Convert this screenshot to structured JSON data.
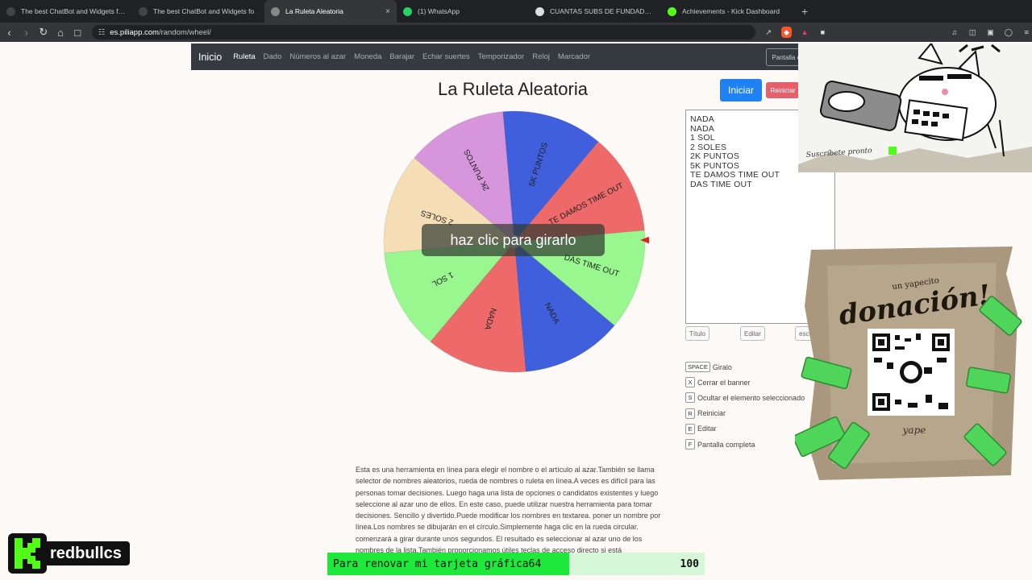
{
  "browser": {
    "tabs": [
      {
        "title": "The best ChatBot and Widgets for Ki",
        "icon": "botrix-icon",
        "color": "#444"
      },
      {
        "title": "The best ChatBot and Widgets fo",
        "icon": "botrix-icon",
        "color": "#444"
      },
      {
        "title": "La Ruleta Aleatoria",
        "icon": "piliapp-icon",
        "color": "#888",
        "active": true
      },
      {
        "title": "(1) WhatsApp",
        "icon": "whatsapp-icon",
        "color": "#25d366"
      },
      {
        "title": "CUANTAS SUBS DE FUNDADOR DAN",
        "icon": "google-icon",
        "color": "#ddd"
      },
      {
        "title": "Achievements - Kick Dashboard",
        "icon": "kick-icon",
        "color": "#53fc18"
      }
    ],
    "url_host": "es.piliapp.com",
    "url_path": "/random/wheel/"
  },
  "site": {
    "brand": "Inicio",
    "nav": [
      "Ruleta",
      "Dado",
      "Números al azar",
      "Moneda",
      "Barajar",
      "Echar suertes",
      "Temporizador",
      "Reloj",
      "Marcador"
    ],
    "active_nav": "Ruleta",
    "fullscreen_btn": "Pantalla completa"
  },
  "wheel": {
    "title": "La Ruleta Aleatoria",
    "overlay_text": "haz clic para girarlo",
    "segments": [
      {
        "label": "DAS TIME OUT",
        "color": "#98f78f"
      },
      {
        "label": "NADA",
        "color": "#3f5fdc"
      },
      {
        "label": "NADA",
        "color": "#ee6a6a"
      },
      {
        "label": "1 SOL",
        "color": "#98f78f"
      },
      {
        "label": "2 SOLES",
        "color": "#f5deb6"
      },
      {
        "label": "2K PUNTOS",
        "color": "#d796dc"
      },
      {
        "label": "5K PUNTOS",
        "color": "#3f5fdc"
      },
      {
        "label": "TE DAMOS TIME OUT",
        "color": "#ee6a6a"
      }
    ],
    "pointer_color": "#e02020"
  },
  "panel": {
    "start": "Iniciar",
    "reset": "Reiniciar",
    "names": [
      "NADA",
      "NADA",
      "1 SOL",
      "2 SOLES",
      "2K PUNTOS",
      "5K PUNTOS",
      "TE DAMOS TIME OUT",
      "DAS TIME OUT"
    ],
    "title_btn": "Título",
    "edit_btn": "Editar",
    "hide_btn": "esconde"
  },
  "shortcuts": [
    {
      "key": "SPACE",
      "label": "Giralo"
    },
    {
      "key": "X",
      "label": "Cerrar el banner"
    },
    {
      "key": "S",
      "label": "Ocultar el elemento seleccionado"
    },
    {
      "key": "R",
      "label": "Reiniciar"
    },
    {
      "key": "E",
      "label": "Editar"
    },
    {
      "key": "F",
      "label": "Pantalla completa"
    }
  ],
  "description": "Esta es una herramienta en línea para elegir el nombre o el artículo al azar.También se llama selector de nombres aleatorios, rueda de nombres o ruleta en línea.A veces es difícil para las personas tomar decisiones. Luego haga una lista de opciones o candidatos existentes y luego seleccione al azar uno de ellos. En este caso, puede utilizar nuestra herramienta para tomar decisiones. Sencillo y divertido.Puede modificar los nombres en textarea. poner un nombre por línea.Los nombres se dibujarán en el círculo.Simplemente haga clic en la rueda circular. comenzará a girar durante unos segundos. El resultado es seleccionar al azar uno de los nombres de la lista.También proporcionamos útiles teclas de acceso directo si está",
  "stream": {
    "channel": "redbullcs",
    "goal_label": "Para renovar mi tarjeta gráfica64",
    "goal_value": "100",
    "goal_progress": 0.64,
    "donation_title": "donación!",
    "donation_sub": "un yapecito",
    "yape_label": "yape",
    "sub_banner": "Suscríbete pronto"
  }
}
